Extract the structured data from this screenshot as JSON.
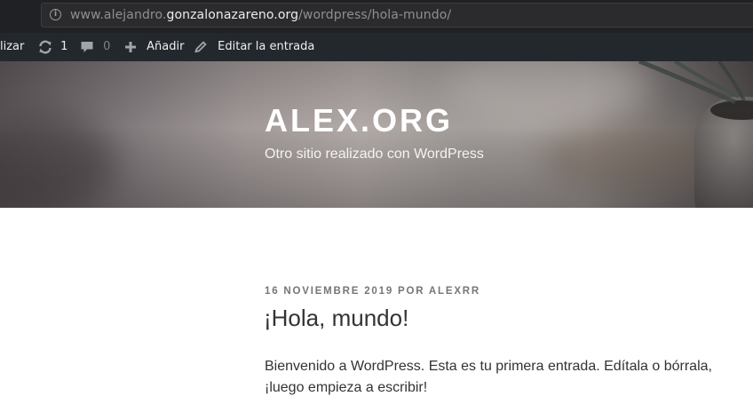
{
  "browser": {
    "url_prefix": "www.alejandro.",
    "url_domain": "gonzalonazareno.org",
    "url_path": "/wordpress/hola-mundo/"
  },
  "adminbar": {
    "customize_label": "lizar",
    "updates_count": "1",
    "comments_count": "0",
    "add_label": "Añadir",
    "edit_label": "Editar la entrada"
  },
  "header": {
    "site_title": "ALEX.ORG",
    "site_description": "Otro sitio realizado con WordPress"
  },
  "post": {
    "date": "16 NOVIEMBRE 2019",
    "by": "POR",
    "author": "ALEXRR",
    "title": "¡Hola, mundo!",
    "body_line1": "Bienvenido a WordPress. Esta es tu primera entrada. Edítala o bórrala,",
    "body_line2": "¡luego empieza a escribir!"
  },
  "icons": [
    "info-icon",
    "refresh-icon",
    "comment-icon",
    "plus-icon",
    "pencil-icon"
  ]
}
